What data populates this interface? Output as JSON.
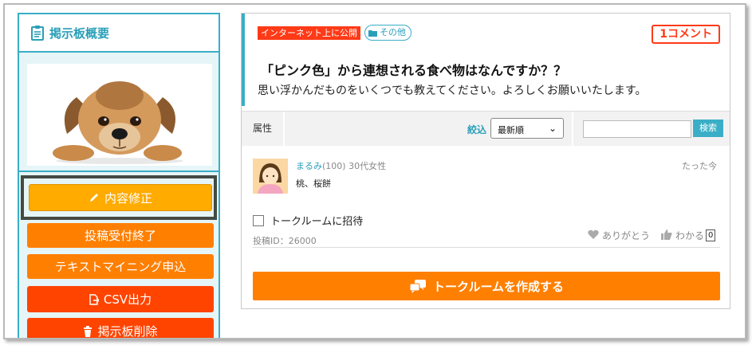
{
  "sidebar": {
    "title": "掲示板概要",
    "buttons": {
      "edit": "内容修正",
      "close_posting": "投稿受付終了",
      "text_mining": "テキストマイニング申込",
      "csv_export": "CSV出力",
      "delete_board": "掲示板削除"
    }
  },
  "post": {
    "visibility_tag": "インターネット上に公開",
    "category_tag": "その他",
    "comment_count": "1コメント",
    "title": "「ピンク色」から連想される食べ物はなんですか？？",
    "description": "思い浮かんだものをいくつでも教えてください。よろしくお願いいたします。"
  },
  "filter": {
    "attribute_label": "属性",
    "narrow_label": "絞込",
    "sort_selected": "最新順",
    "search_button": "検索"
  },
  "comment": {
    "user": "まるみ",
    "points": "(100)",
    "demographic": "30代女性",
    "time": "たった今",
    "text": "桃、桜餅",
    "invite_label": "トークルームに招待",
    "post_id": "投稿ID：26000",
    "thanks_label": "ありがとう",
    "agree_label": "わかる",
    "agree_count": "0"
  },
  "actions": {
    "create_room": "トークルームを作成する"
  },
  "colors": {
    "accent": "#3aaec6",
    "orange": "#ff7f00",
    "red": "#ff4400",
    "yellow": "#ffab00"
  }
}
